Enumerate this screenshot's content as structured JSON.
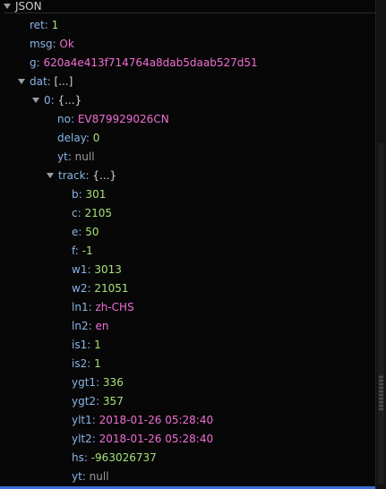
{
  "root": {
    "label": "JSON"
  },
  "rows": [
    {
      "key": "ret",
      "value": "1",
      "type": "num"
    },
    {
      "key": "msg",
      "value": "Ok",
      "type": "str"
    },
    {
      "key": "g",
      "value": "620a4e413f714764a8dab5daab527d51",
      "type": "str"
    },
    {
      "key": "dat",
      "value": "[...]",
      "type": "sum"
    },
    {
      "key": "0",
      "value": "{...}",
      "type": "sum"
    },
    {
      "key": "no",
      "value": "EV879929026CN",
      "type": "str"
    },
    {
      "key": "delay",
      "value": "0",
      "type": "num"
    },
    {
      "key": "yt",
      "value": "null",
      "type": "nul"
    },
    {
      "key": "track",
      "value": "{...}",
      "type": "sum"
    },
    {
      "key": "b",
      "value": "301",
      "type": "num"
    },
    {
      "key": "c",
      "value": "2105",
      "type": "num"
    },
    {
      "key": "e",
      "value": "50",
      "type": "num"
    },
    {
      "key": "f",
      "value": "-1",
      "type": "num"
    },
    {
      "key": "w1",
      "value": "3013",
      "type": "num"
    },
    {
      "key": "w2",
      "value": "21051",
      "type": "num"
    },
    {
      "key": "ln1",
      "value": "zh-CHS",
      "type": "str"
    },
    {
      "key": "ln2",
      "value": "en",
      "type": "str"
    },
    {
      "key": "is1",
      "value": "1",
      "type": "num"
    },
    {
      "key": "is2",
      "value": "1",
      "type": "num"
    },
    {
      "key": "ygt1",
      "value": "336",
      "type": "num"
    },
    {
      "key": "ygt2",
      "value": "357",
      "type": "num"
    },
    {
      "key": "ylt1",
      "value": "2018-01-26 05:28:40",
      "type": "str"
    },
    {
      "key": "ylt2",
      "value": "2018-01-26 05:28:40",
      "type": "str"
    },
    {
      "key": "hs",
      "value": "-963026737",
      "type": "num"
    },
    {
      "key": "yt",
      "value": "null",
      "type": "nul"
    }
  ]
}
